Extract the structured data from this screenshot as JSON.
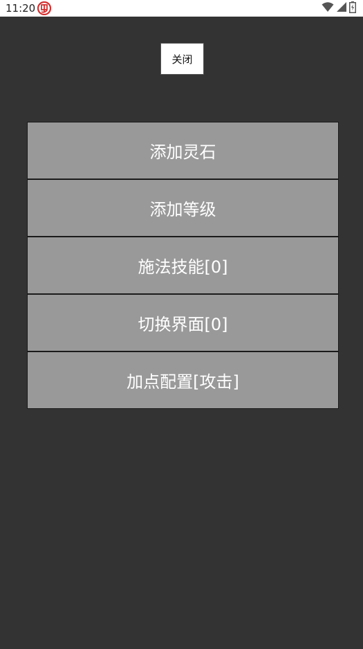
{
  "status_bar": {
    "time": "11:20",
    "notification_icon": "app-notification-icon",
    "wifi_icon": "wifi-icon",
    "signal_icon": "cell-signal-icon",
    "battery_icon": "battery-icon"
  },
  "close_button": {
    "label": "关闭"
  },
  "menu": {
    "items": [
      {
        "label": "添加灵石"
      },
      {
        "label": "添加等级"
      },
      {
        "label": "施法技能[0]"
      },
      {
        "label": "切换界面[0]"
      },
      {
        "label": "加点配置[攻击]"
      }
    ]
  },
  "colors": {
    "background": "#333333",
    "menu_item": "#999999",
    "close_button_bg": "#ffffff",
    "notification_red": "#d32f2f"
  }
}
